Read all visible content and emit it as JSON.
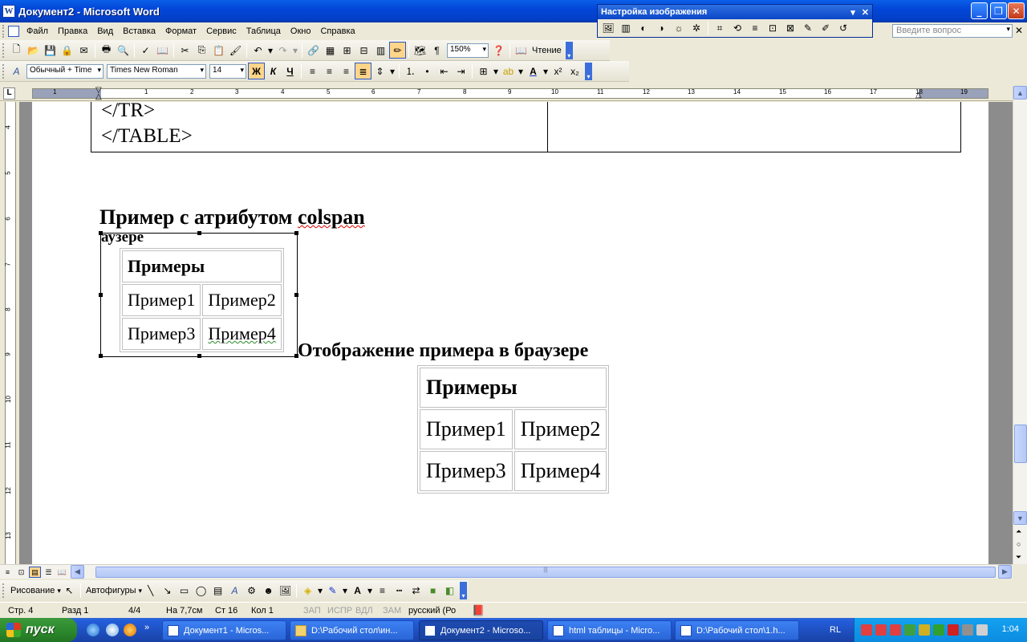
{
  "window": {
    "title": "Документ2 - Microsoft Word",
    "app_icon": "W"
  },
  "menu": {
    "items": [
      "Файл",
      "Правка",
      "Вид",
      "Вставка",
      "Формат",
      "Сервис",
      "Таблица",
      "Окно",
      "Справка"
    ],
    "help_placeholder": "Введите вопрос"
  },
  "standard_toolbar": {
    "zoom": "150%",
    "read_label": "Чтение"
  },
  "formatting_toolbar": {
    "style": "Обычный + Time",
    "font": "Times New Roman",
    "size": "14",
    "bold": "Ж",
    "italic": "К",
    "underline": "Ч"
  },
  "picture_toolbar": {
    "title": "Настройка изображения"
  },
  "ruler": {
    "h_numbers": [
      "1",
      "1",
      "2",
      "3",
      "4",
      "5",
      "6",
      "7",
      "8",
      "9",
      "10",
      "11",
      "12",
      "13",
      "14",
      "15",
      "16",
      "17",
      "18",
      "19"
    ],
    "v_numbers": [
      "4",
      "5",
      "6",
      "7",
      "8",
      "9",
      "10",
      "11",
      "12",
      "13"
    ]
  },
  "document": {
    "src_lines": [
      "</TR>",
      "</TABLE>"
    ],
    "heading1_prefix": "Пример с атрибутом ",
    "heading1_word": "colspan",
    "cut_text": "аузере",
    "heading2": "Отображение примера в браузере",
    "table": {
      "header": "Примеры",
      "rows": [
        [
          "Пример1",
          "Пример2"
        ],
        [
          "Пример3",
          "Пример4"
        ]
      ]
    }
  },
  "drawing_toolbar": {
    "draw_label": "Рисование",
    "autoshapes_label": "Автофигуры"
  },
  "status": {
    "page": "Стр. 4",
    "section": "Разд 1",
    "pages": "4/4",
    "at": "На 7,7см",
    "line": "Ст 16",
    "col": "Кол 1",
    "rec": "ЗАП",
    "trk": "ИСПР",
    "ext": "ВДЛ",
    "ovr": "ЗАМ",
    "language": "русский (Ро"
  },
  "taskbar": {
    "start": "пуск",
    "tasks": [
      "Документ1 - Micros...",
      "D:\\Рабочий стол\\ин...",
      "Документ2 - Microso...",
      "html таблицы - Micro...",
      "D:\\Рабочий стол\\1.h..."
    ],
    "lang": "RL",
    "clock": "1:04"
  },
  "colors": {
    "titlebar": "#0a5fe8",
    "taskbar": "#245edb",
    "start": "#2d8b2d",
    "wavy_underline": "#d00000"
  }
}
